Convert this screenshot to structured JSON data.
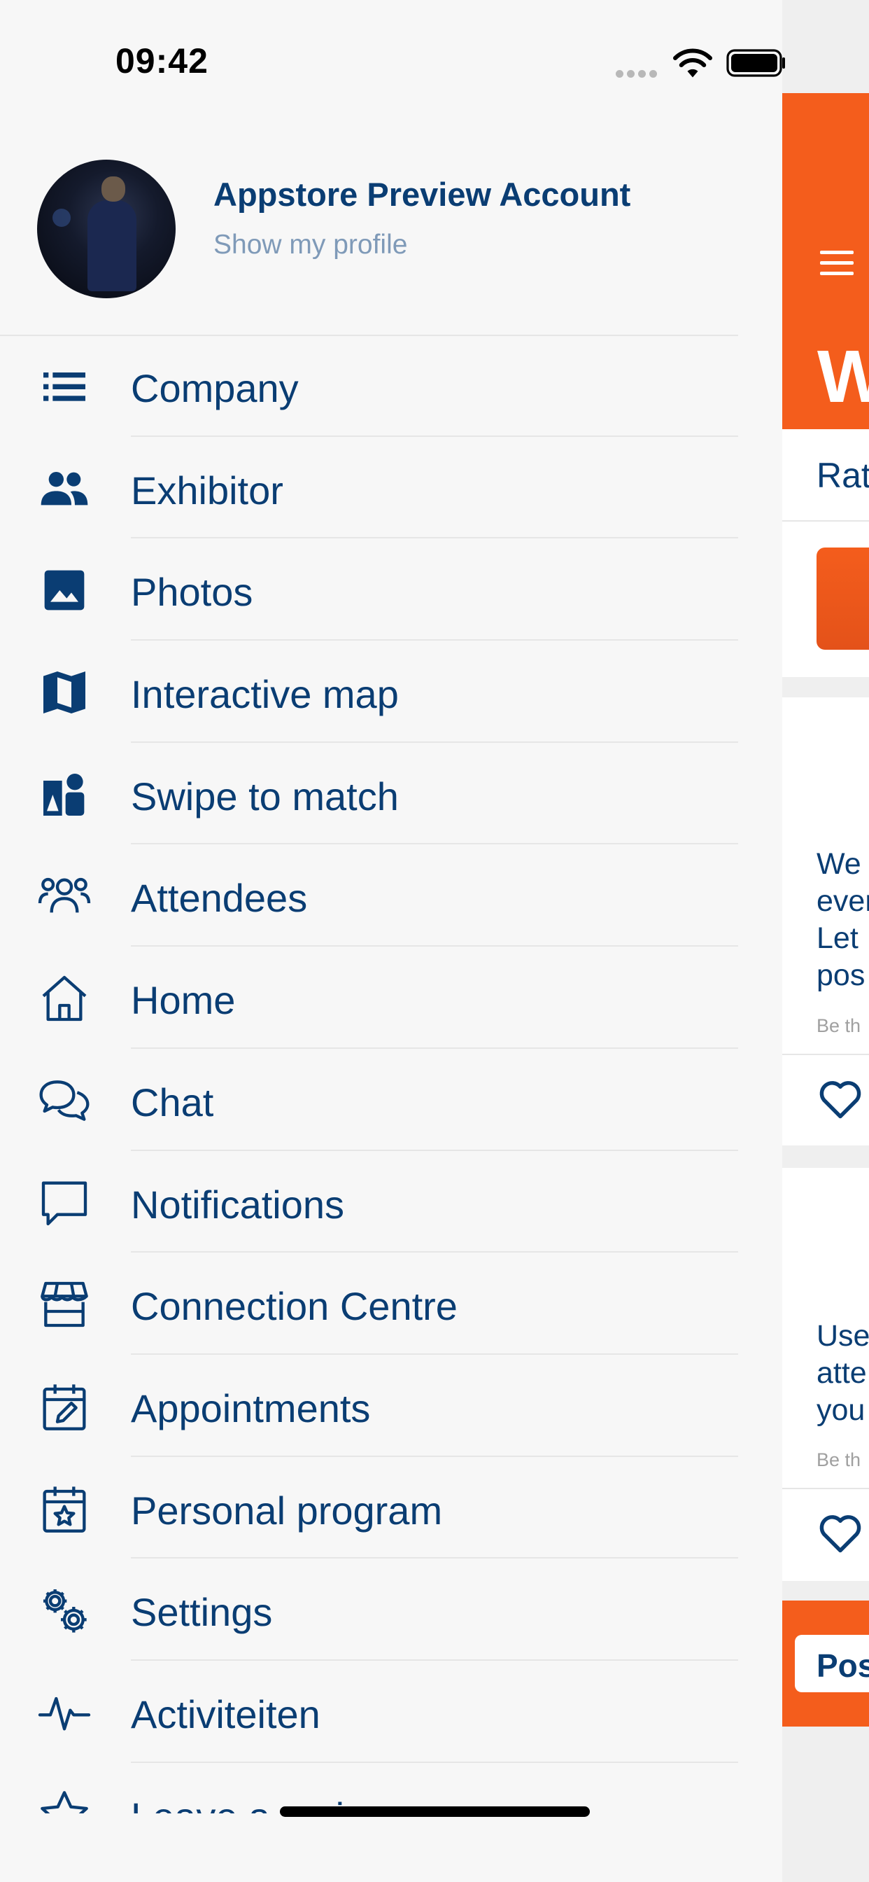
{
  "status_bar": {
    "time": "09:42"
  },
  "profile": {
    "name": "Appstore Preview Account",
    "subtitle": "Show my profile"
  },
  "menu": {
    "items": [
      {
        "label": "Company",
        "icon": "list-icon"
      },
      {
        "label": "Exhibitor",
        "icon": "people-icon"
      },
      {
        "label": "Photos",
        "icon": "image-icon"
      },
      {
        "label": "Interactive map",
        "icon": "map-icon"
      },
      {
        "label": "Swipe to match",
        "icon": "swipe-match-icon"
      },
      {
        "label": "Attendees",
        "icon": "attendees-icon"
      },
      {
        "label": "Home",
        "icon": "home-icon"
      },
      {
        "label": "Chat",
        "icon": "chat-bubbles-icon"
      },
      {
        "label": "Notifications",
        "icon": "speech-bubble-icon"
      },
      {
        "label": "Connection Centre",
        "icon": "storefront-icon"
      },
      {
        "label": "Appointments",
        "icon": "calendar-edit-icon"
      },
      {
        "label": "Personal program",
        "icon": "calendar-star-icon"
      },
      {
        "label": "Settings",
        "icon": "gears-icon"
      },
      {
        "label": "Activiteiten",
        "icon": "activity-pulse-icon"
      },
      {
        "label": "Leave a review",
        "icon": "star-icon"
      }
    ]
  },
  "background_page": {
    "title_fragment": "W",
    "rate_fragment": "Rat",
    "card1_lines": [
      "We",
      "ever",
      "Let",
      "pos"
    ],
    "card1_footer": "Be th",
    "card2_lines": [
      "Use",
      "atte",
      "you"
    ],
    "card2_footer": "Be th",
    "post_button": "Pos"
  },
  "colors": {
    "primary_text": "#0a3d73",
    "accent_orange": "#f45d1c",
    "muted_text": "#7f9ab8",
    "background": "#f7f7f7"
  }
}
